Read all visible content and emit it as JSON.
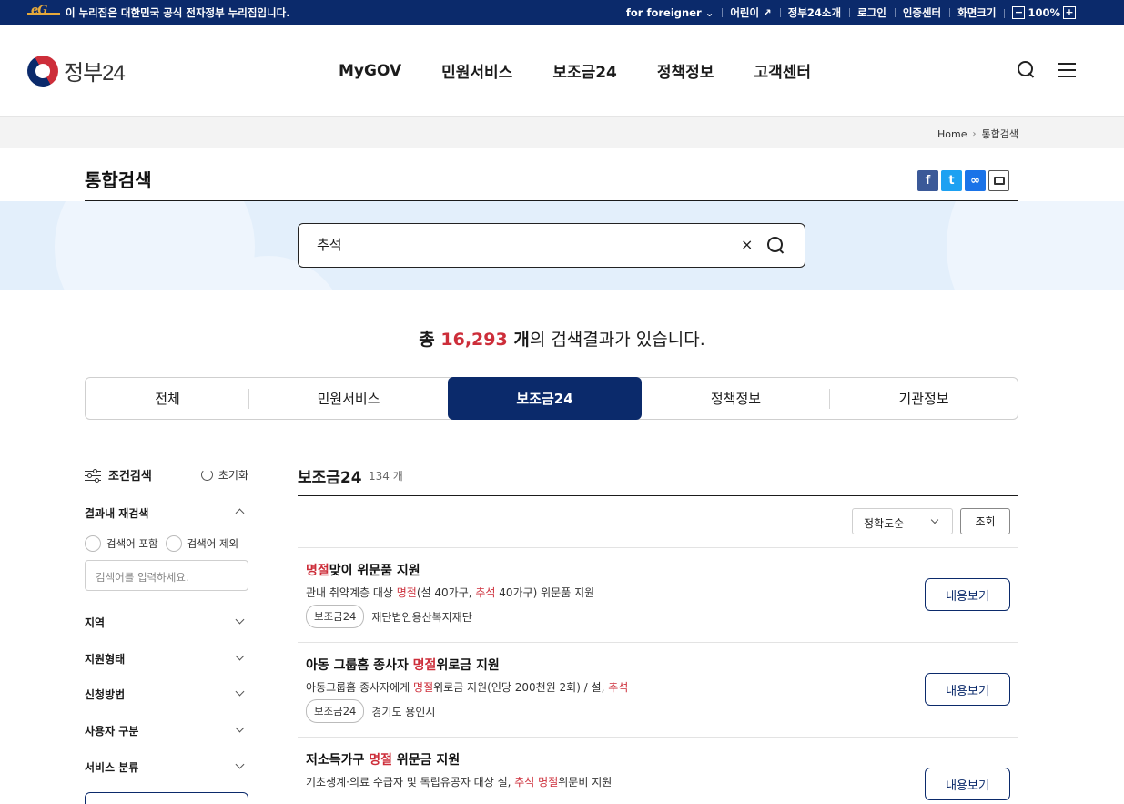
{
  "gov_bar": {
    "notice": "이 누리집은 대한민국 공식 전자정부 누리집입니다.",
    "links": [
      "for foreigner",
      "어린이",
      "정부24소개",
      "로그인",
      "인증센터",
      "화면크기"
    ],
    "zoom": "100%",
    "zoom_minus": "−",
    "zoom_plus": "+"
  },
  "header": {
    "logo_text": "정부24",
    "nav": [
      "MyGOV",
      "민원서비스",
      "보조금24",
      "정책정보",
      "고객센터"
    ]
  },
  "breadcrumb": {
    "home": "Home",
    "current": "통합검색"
  },
  "page": {
    "title": "통합검색"
  },
  "share": {
    "facebook": "f",
    "twitter": "t",
    "link": "∞"
  },
  "search": {
    "value": "추석",
    "clear": "×"
  },
  "result": {
    "prefix": "총 ",
    "count": "16,293",
    "unit": " 개",
    "suffix": "의 검색결과가 있습니다."
  },
  "tabs": [
    "전체",
    "민원서비스",
    "보조금24",
    "정책정보",
    "기관정보"
  ],
  "active_tab": "보조금24",
  "filter": {
    "title": "조건검색",
    "reset": "초기화",
    "research_label": "결과내 재검색",
    "include": "검색어 포함",
    "exclude": "검색어 제외",
    "input_placeholder": "검색어를 입력하세요.",
    "sections": [
      "지역",
      "지원형태",
      "신청방법",
      "사용자 구분",
      "서비스 분류"
    ]
  },
  "results": {
    "title": "보조금24",
    "count": "134 개",
    "sort": "정확도순",
    "query_button": "조회",
    "items": [
      {
        "title_hl": "명절",
        "title_rest": "맞이 위문품 지원",
        "desc_parts": [
          "관내 취약계층 대상 ",
          "명절",
          "(설 40가구, ",
          "추석",
          " 40가구) 위문품 지원"
        ],
        "badge": "보조금24",
        "org": "재단법인용산복지재단",
        "button": "내용보기"
      },
      {
        "title_pre": "아동 그룹홈 종사자 ",
        "title_hl": "명절",
        "title_rest": "위로금 지원",
        "desc_parts": [
          "아동그룹홈 종사자에게 ",
          "명절",
          "위로금 지원(인당 200천원 2회) / 설, ",
          "추석",
          ""
        ],
        "badge": "보조금24",
        "org": "경기도 용인시",
        "button": "내용보기"
      },
      {
        "title_pre": "저소득가구 ",
        "title_hl": "명절",
        "title_rest": " 위문금 지원",
        "desc_parts": [
          "기초생계·의료 수급자 및 독립유공자 대상 설, ",
          "추석",
          " ",
          "명절",
          "위문비 지원"
        ],
        "button": "내용보기"
      }
    ]
  },
  "colors": {
    "navy": "#0b2a6b",
    "red": "#cd2e3a"
  }
}
